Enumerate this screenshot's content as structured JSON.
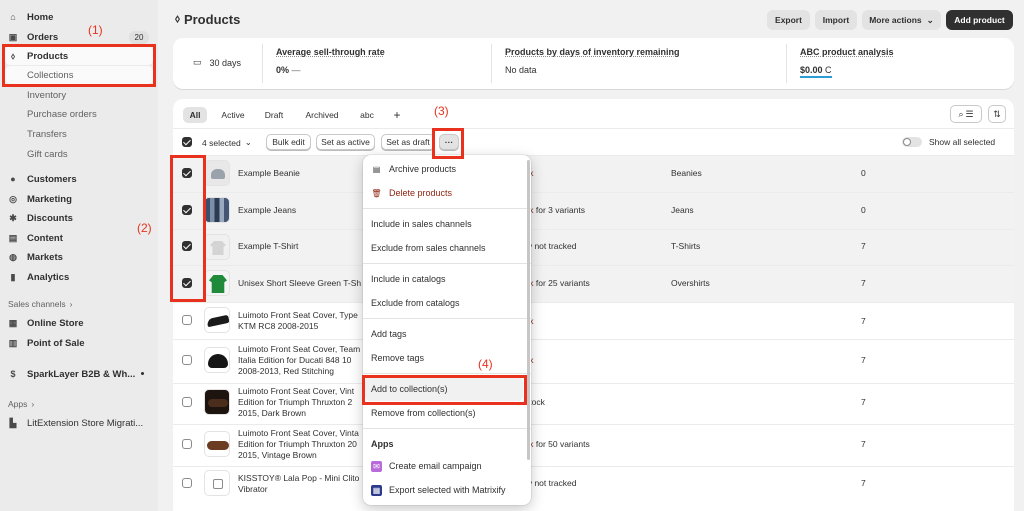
{
  "sidebar": {
    "items": [
      {
        "label": "Home",
        "icon": "home-icon"
      },
      {
        "label": "Orders",
        "icon": "orders-icon",
        "badge": "20"
      },
      {
        "label": "Products",
        "icon": "tag-icon"
      },
      {
        "label": "Collections"
      },
      {
        "label": "Inventory"
      },
      {
        "label": "Purchase orders"
      },
      {
        "label": "Transfers"
      },
      {
        "label": "Gift cards"
      },
      {
        "label": "Customers",
        "icon": "person-icon"
      },
      {
        "label": "Marketing",
        "icon": "marketing-icon"
      },
      {
        "label": "Discounts",
        "icon": "discount-icon"
      },
      {
        "label": "Content",
        "icon": "content-icon"
      },
      {
        "label": "Markets",
        "icon": "globe-icon"
      },
      {
        "label": "Analytics",
        "icon": "chart-icon"
      }
    ],
    "sales_channels_label": "Sales channels",
    "channels": [
      {
        "label": "Online Store",
        "icon": "store-icon"
      },
      {
        "label": "Point of Sale",
        "icon": "pos-icon"
      },
      {
        "label": "SparkLayer B2B & Wh...",
        "icon": "sparklayer-icon"
      }
    ],
    "apps_label": "Apps",
    "apps": [
      {
        "label": "LitExtension Store Migrati...",
        "icon": "litextension-icon"
      }
    ]
  },
  "header": {
    "title": "Products",
    "export": "Export",
    "import": "Import",
    "more_actions": "More actions",
    "add_product": "Add product"
  },
  "metrics": {
    "period": "30 days",
    "sell_through_label": "Average sell-through rate",
    "sell_through_value": "0%",
    "sell_through_trend": "—",
    "days_inventory_label": "Products by days of inventory remaining",
    "days_inventory_value": "No data",
    "abc_label": "ABC product analysis",
    "abc_value": "$0.00",
    "abc_grade": "C"
  },
  "tabs": [
    "All",
    "Active",
    "Draft",
    "Archived",
    "abc",
    "+"
  ],
  "bulk": {
    "selected": "4 selected",
    "bulk_edit": "Bulk edit",
    "set_active": "Set as active",
    "set_draft": "Set as draft",
    "more": "···",
    "show_all_selected": "Show all selected"
  },
  "products": [
    {
      "name": "Example Beanie",
      "stock": "ck",
      "stock_rest": "",
      "type": "Beanies",
      "count": "0",
      "selected": true
    },
    {
      "name": "Example Jeans",
      "stock": "ck",
      "stock_rest": " for 3 variants",
      "type": "Jeans",
      "count": "0",
      "selected": true
    },
    {
      "name": "Example T-Shirt",
      "stock": "",
      "stock_rest": "ry not tracked",
      "type": "T-Shirts",
      "count": "7",
      "selected": true
    },
    {
      "name": "Unisex Short Sleeve Green T-Sh",
      "stock": "ck",
      "stock_rest": " for 25 variants",
      "type": "Overshirts",
      "count": "7",
      "selected": true
    },
    {
      "name": "Luimoto Front Seat Cover, Type KTM RC8 2008-2015",
      "stock": "ck",
      "stock_rest": "",
      "type": "",
      "count": "7",
      "selected": false
    },
    {
      "name": "Luimoto Front Seat Cover, Team Italia Edition for Ducati 848 10 2008-2013, Red Stitching",
      "stock": "ck",
      "stock_rest": "",
      "type": "",
      "count": "7",
      "selected": false
    },
    {
      "name": "Luimoto Front Seat Cover, Vint Edition for Triumph Thruxton 2 2015, Dark Brown",
      "stock": "",
      "stock_rest": "stock",
      "type": "",
      "count": "7",
      "selected": false
    },
    {
      "name": "Luimoto Front Seat Cover, Vinta Edition for Triumph Thruxton 20 2015, Vintage Brown",
      "stock": "ck",
      "stock_rest": " for 50 variants",
      "type": "",
      "count": "7",
      "selected": false
    },
    {
      "name": "KISSTOY® Lala Pop - Mini Clito Vibrator",
      "stock": "",
      "stock_rest": "ry not tracked",
      "type": "",
      "count": "7",
      "selected": false
    }
  ],
  "menu": {
    "archive": "Archive products",
    "delete": "Delete products",
    "include_sales": "Include in sales channels",
    "exclude_sales": "Exclude from sales channels",
    "include_catalogs": "Include in catalogs",
    "exclude_catalogs": "Exclude from catalogs",
    "add_tags": "Add tags",
    "remove_tags": "Remove tags",
    "add_collection": "Add to collection(s)",
    "remove_collection": "Remove from collection(s)",
    "apps_header": "Apps",
    "email_campaign": "Create email campaign",
    "matrixify": "Export selected with Matrixify"
  },
  "annotations": {
    "a1": "(1)",
    "a2": "(2)",
    "a3": "(3)",
    "a4": "(4)"
  },
  "colors": {
    "annotation_red": "#e8321e",
    "delete_red": "#8e1f0b",
    "primary_dark": "#303030"
  }
}
